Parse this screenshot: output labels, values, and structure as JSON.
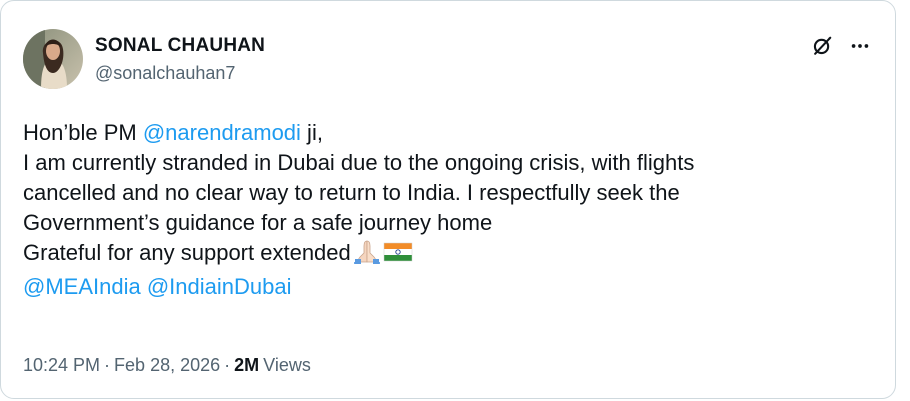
{
  "author": {
    "display_name": "SONAL CHAUHAN",
    "handle": "@sonalchauhan7"
  },
  "icons": {
    "top_right": [
      "grok-icon",
      "more-options-icon"
    ]
  },
  "tweet": {
    "line1_prefix": "Hon’ble PM ",
    "line1_mention": "@narendramodi",
    "line1_suffix": " ji,",
    "line2": "I am currently stranded in Dubai due to the ongoing crisis, with flights",
    "line3": "cancelled and no clear way to return to India. I respectfully seek the",
    "line4": "Government’s guidance for a safe journey home",
    "line5": "Grateful for any support extended",
    "emojis": [
      "folded-hands-emoji",
      "india-flag-emoji"
    ],
    "mention_mea": "@MEAIndia",
    "mention_dubai": "@IndiainDubai"
  },
  "meta": {
    "time": "10:24 PM",
    "separator": "·",
    "date": "Feb 28, 2026",
    "views_count": "2M",
    "views_label": "Views"
  },
  "colors": {
    "text": "#0f1419",
    "secondary": "#536471",
    "link": "#1d9bf0",
    "border": "#cfd9de"
  }
}
